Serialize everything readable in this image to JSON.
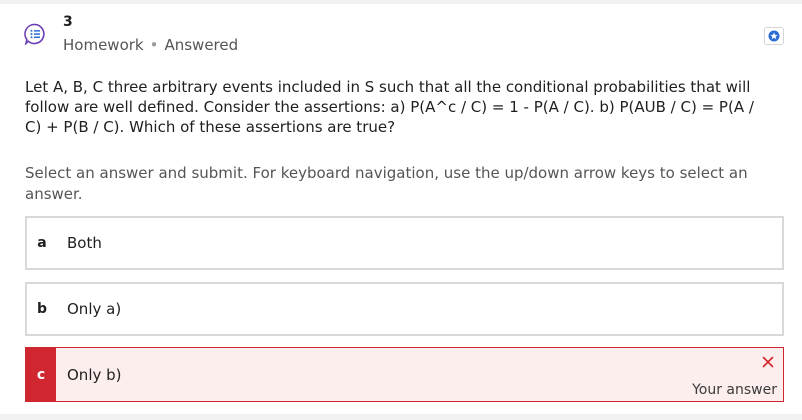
{
  "question": {
    "number": "3",
    "type_label": "Homework",
    "status_label": "Answered",
    "text": "Let A, B, C three arbitrary events included in S such that all the conditional probabilities that will follow are well defined. Consider the assertions: a) P(A^c / C) = 1 - P(A / C). b) P(AUB / C) = P(A / C) + P(B / C). Which of these assertions are true?",
    "instructions": "Select an answer and submit. For keyboard navigation, use the up/down arrow keys to select an answer."
  },
  "options": [
    {
      "letter": "a",
      "label": "Both"
    },
    {
      "letter": "b",
      "label": "Only a)"
    },
    {
      "letter": "c",
      "label": "Only b)",
      "state": "incorrect",
      "note": "Your answer"
    }
  ],
  "icons": {
    "question_type": "question-bubble-icon",
    "flag": "star-badge-icon",
    "incorrect": "close-x-icon"
  },
  "colors": {
    "incorrect": "#d0262f",
    "incorrect_bg": "#fdeeee",
    "accent": "#2b6cd6",
    "icon_purple": "#6a3db8"
  }
}
